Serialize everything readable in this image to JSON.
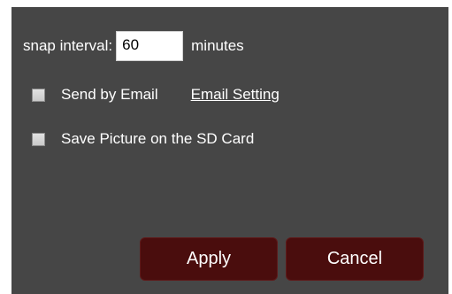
{
  "snap_interval": {
    "label": "snap interval:",
    "value": "60",
    "unit": "minutes"
  },
  "send_by_email": {
    "label": "Send by Email",
    "checked": false,
    "settings_link": "Email Setting"
  },
  "save_sd": {
    "label": "Save Picture on the SD Card",
    "checked": false
  },
  "buttons": {
    "apply": "Apply",
    "cancel": "Cancel"
  },
  "colors": {
    "panel_background": "#464646",
    "button_background": "#4a0d0d",
    "text": "#ffffff"
  }
}
